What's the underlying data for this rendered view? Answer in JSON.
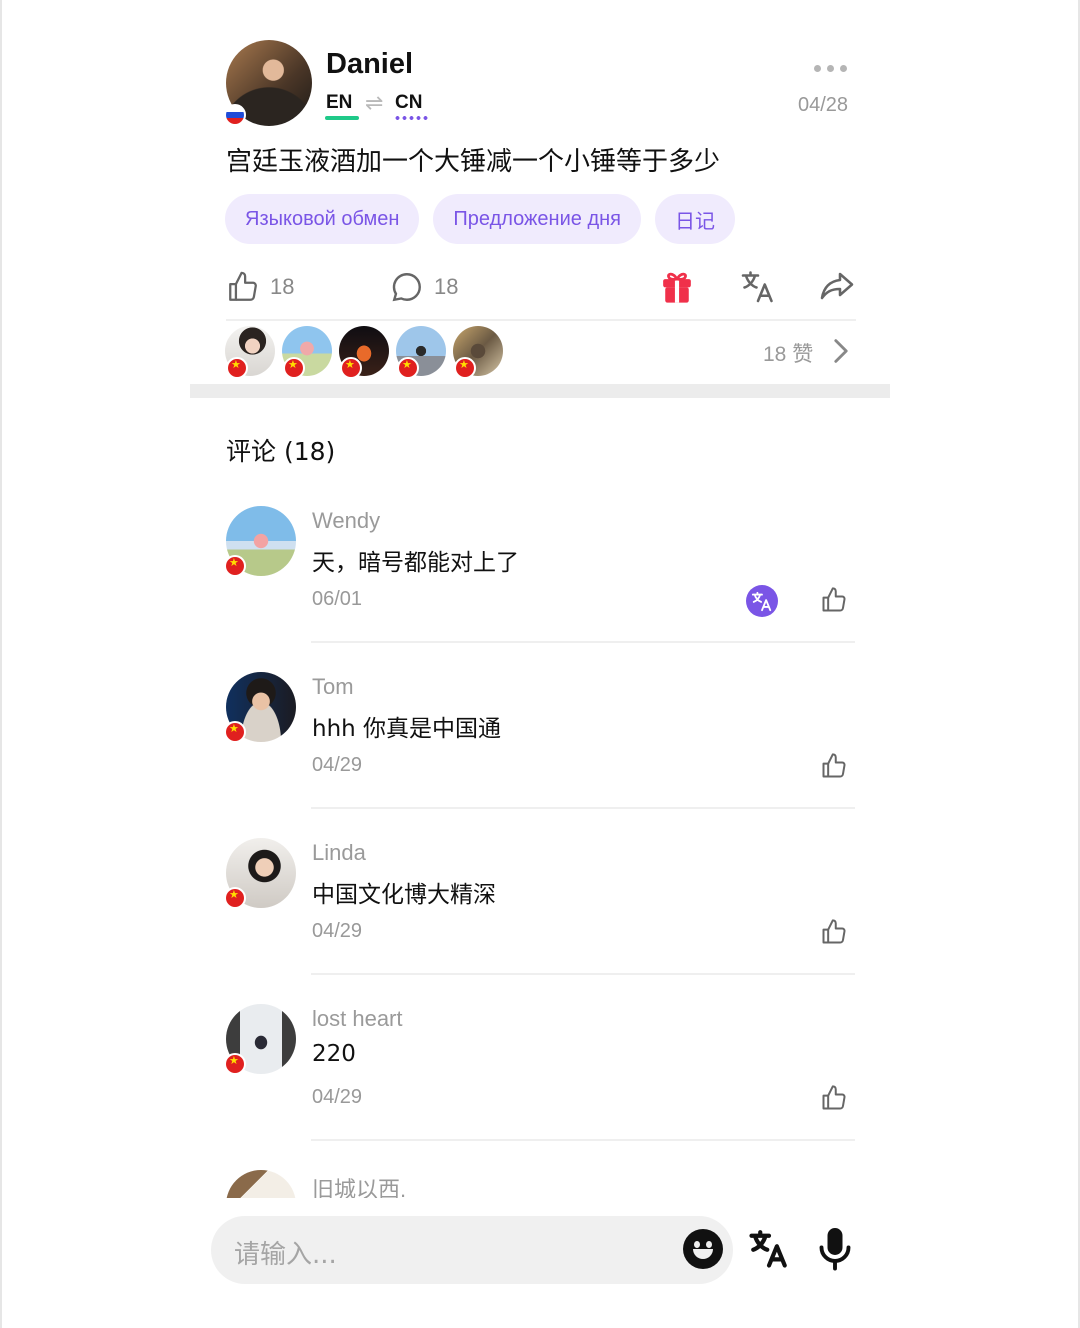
{
  "post": {
    "author": "Daniel",
    "native_lang": "EN",
    "swap_symbol": "⇌",
    "learning_lang": "CN",
    "date": "04/28",
    "text": "宫廷玉液酒加一个大锤减一个小锤等于多少",
    "tags": [
      "Языковой обмен",
      "Предложение дня",
      "日记"
    ],
    "like_count": "18",
    "comment_count": "18",
    "likers_summary": "18 赞",
    "author_flag": "russia",
    "liker_flags": [
      "china",
      "china",
      "china",
      "china",
      "china"
    ]
  },
  "comments_section": {
    "title": "评论 (18)",
    "items": [
      {
        "name": "Wendy",
        "text": "天，暗号都能对上了",
        "date": "06/01",
        "flag": "china",
        "has_translate": true
      },
      {
        "name": "Tom",
        "text": "hhh 你真是中国通",
        "date": "04/29",
        "flag": "china",
        "has_translate": false
      },
      {
        "name": "Linda",
        "text": "中国文化博大精深",
        "date": "04/29",
        "flag": "china",
        "has_translate": false
      },
      {
        "name": "lost heart",
        "text": "220",
        "date": "04/29",
        "flag": "china",
        "has_translate": false
      },
      {
        "name": "旧城以西.",
        "text": "",
        "date": "",
        "flag": "",
        "has_translate": false
      }
    ]
  },
  "composer": {
    "placeholder": "请输入..."
  },
  "colors": {
    "accent": "#7a55e6",
    "native_lang_bar": "#1fc989",
    "gift": "#f0304a"
  }
}
